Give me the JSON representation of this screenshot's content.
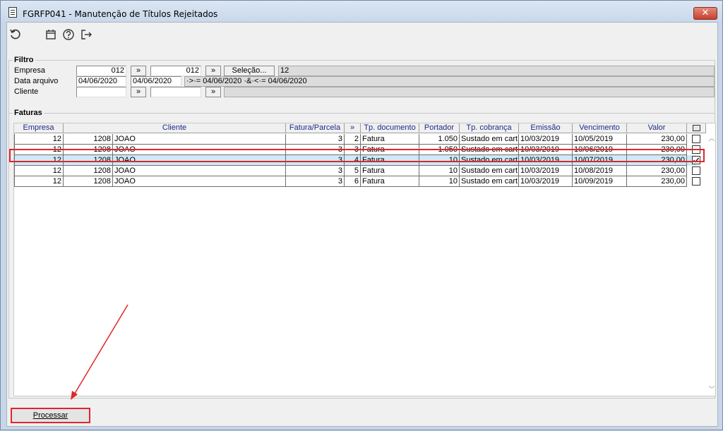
{
  "window": {
    "title": "FGRFP041 - Manutenção de Títulos Rejeitados",
    "close_label": "✕"
  },
  "toolbar": {
    "icons": [
      "refresh-icon",
      "calendar-icon",
      "help-icon",
      "exit-icon"
    ]
  },
  "filtro": {
    "title": "Filtro",
    "empresa": {
      "label": "Empresa",
      "from": "012",
      "to": "012",
      "btn": "»",
      "selecao_label": "Seleção...",
      "display": "12"
    },
    "data_arquivo": {
      "label": "Data arquivo",
      "from": "04/06/2020",
      "to": "04/06/2020",
      "display": "·>·= 04/06/2020 ·&·<·= 04/06/2020"
    },
    "cliente": {
      "label": "Cliente",
      "from": "",
      "to": "",
      "btn": "»"
    }
  },
  "faturas": {
    "title": "Faturas",
    "columns": [
      "Empresa",
      "Cliente",
      "Fatura/Parcela",
      "»",
      "Tp. documento",
      "Portador",
      "Tp. cobrança",
      "Emissão",
      "Vencimento",
      "Valor"
    ],
    "rows": [
      {
        "empresa": "12",
        "cliente_cod": "1208",
        "cliente_nome": "JOAO",
        "fatura": "3",
        "parcela": "2",
        "tp_doc": "Fatura",
        "portador": "1.050",
        "tp_cob": "Sustado em cart",
        "emissao": "10/03/2019",
        "vencimento": "10/05/2019",
        "valor": "230,00",
        "checked": false
      },
      {
        "empresa": "12",
        "cliente_cod": "1208",
        "cliente_nome": "JOAO",
        "fatura": "3",
        "parcela": "3",
        "tp_doc": "Fatura",
        "portador": "1.050",
        "tp_cob": "Sustado em cart",
        "emissao": "10/03/2019",
        "vencimento": "10/06/2019",
        "valor": "230,00",
        "checked": false
      },
      {
        "empresa": "12",
        "cliente_cod": "1208",
        "cliente_nome": "JOAO",
        "fatura": "3",
        "parcela": "4",
        "tp_doc": "Fatura",
        "portador": "10",
        "tp_cob": "Sustado em cart",
        "emissao": "10/03/2019",
        "vencimento": "10/07/2019",
        "valor": "230,00",
        "checked": true
      },
      {
        "empresa": "12",
        "cliente_cod": "1208",
        "cliente_nome": "JOAO",
        "fatura": "3",
        "parcela": "5",
        "tp_doc": "Fatura",
        "portador": "10",
        "tp_cob": "Sustado em cart",
        "emissao": "10/03/2019",
        "vencimento": "10/08/2019",
        "valor": "230,00",
        "checked": false
      },
      {
        "empresa": "12",
        "cliente_cod": "1208",
        "cliente_nome": "JOAO",
        "fatura": "3",
        "parcela": "6",
        "tp_doc": "Fatura",
        "portador": "10",
        "tp_cob": "Sustado em cart",
        "emissao": "10/03/2019",
        "vencimento": "10/09/2019",
        "valor": "230,00",
        "checked": false
      }
    ]
  },
  "footer": {
    "processar_label": "Processar"
  },
  "colors": {
    "highlight": "#e0262b",
    "selected_row": "#cfe9f6",
    "header_text": "#1c2a8a"
  }
}
